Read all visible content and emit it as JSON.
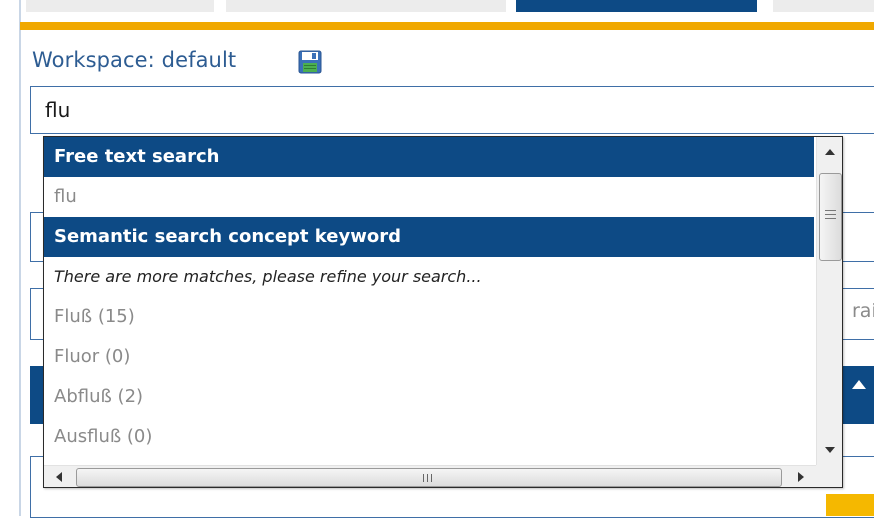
{
  "workspace": {
    "label": "Workspace: default",
    "save_icon": "floppy-disk-save-icon"
  },
  "search": {
    "value": "flu"
  },
  "background": {
    "field_right_text": "rai"
  },
  "autocomplete": {
    "sections": [
      {
        "header": "Free text search",
        "items": [
          "flu"
        ]
      },
      {
        "header": "Semantic search concept keyword",
        "note": "There are more matches, please refine your search...",
        "items": [
          "Fluß (15)",
          "Fluor (0)",
          "Abfluß (2)",
          "Ausfluß (0)"
        ]
      }
    ]
  },
  "colors": {
    "header_bg": "#0d4a85",
    "accent_orange": "#f0a800",
    "label_blue": "#2d5c92",
    "item_gray": "#8a8a8a"
  }
}
